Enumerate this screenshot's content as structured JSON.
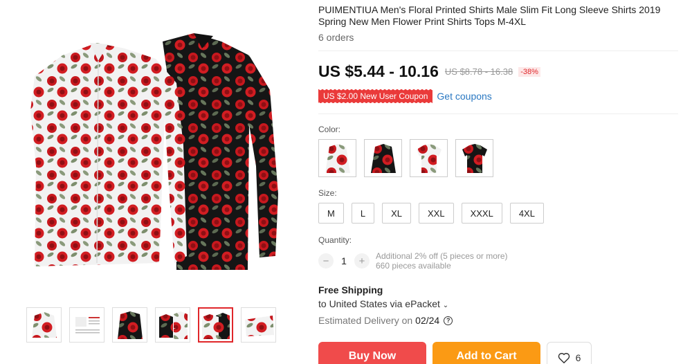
{
  "product": {
    "title": "PUIMENTIUA Men's Floral Printed Shirts Male Slim Fit Long Sleeve Shirts 2019 Spring New Men Flower Print Shirts Tops M-4XL",
    "orders": "6 orders"
  },
  "price": {
    "current": "US $5.44 - 10.16",
    "original": "US $8.78 - 16.38",
    "discount": "-38%"
  },
  "coupon": {
    "label": "US $2.00 New User Coupon",
    "link": "Get coupons"
  },
  "color": {
    "label": "Color:",
    "options": [
      "white-red-long-sleeve",
      "black-red-long-sleeve",
      "white-red-short-sleeve",
      "black-red-short-sleeve"
    ]
  },
  "size": {
    "label": "Size:",
    "options": [
      "M",
      "L",
      "XL",
      "XXL",
      "XXXL",
      "4XL"
    ]
  },
  "quantity": {
    "label": "Quantity:",
    "value": "1",
    "decrement": "−",
    "increment": "+",
    "note": "Additional 2% off (5 pieces or more)",
    "available": "660 pieces available"
  },
  "shipping": {
    "title": "Free Shipping",
    "to": "to United States via ePacket",
    "eta_label": "Estimated Delivery on",
    "eta_date": "02/24",
    "help": "?"
  },
  "actions": {
    "buy": "Buy Now",
    "cart": "Add to Cart",
    "wish_count": "6"
  },
  "colors": {
    "accent_red": "#e0262a",
    "buy_button": "#f04b4b",
    "cart_button": "#fb9a14",
    "link_blue": "#2a78c2"
  }
}
